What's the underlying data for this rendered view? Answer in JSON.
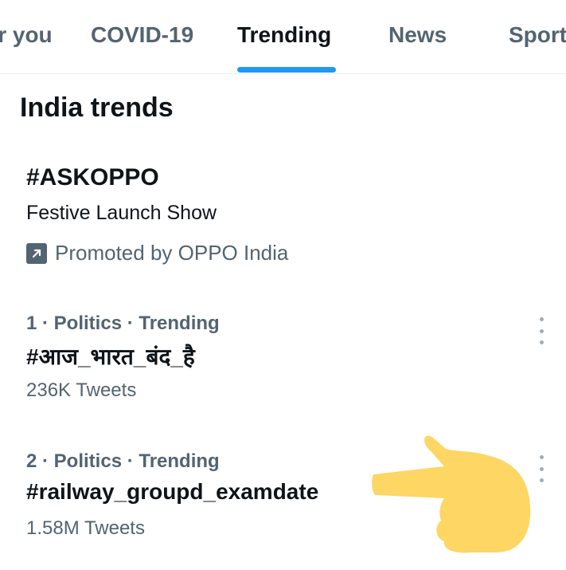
{
  "tabs": [
    {
      "label": "For you"
    },
    {
      "label": "COVID-19"
    },
    {
      "label": "Trending"
    },
    {
      "label": "News"
    },
    {
      "label": "Sports"
    }
  ],
  "section": {
    "title": "India trends"
  },
  "promoted": {
    "hashtag": "#ASKOPPO",
    "subtitle": "Festive Launch Show",
    "promoted_by": "Promoted by OPPO India",
    "icon": "promoted-arrow-icon"
  },
  "trends": [
    {
      "meta": "1 · Politics · Trending",
      "tag": "#आज_भारत_बंद_है",
      "count": "236K Tweets"
    },
    {
      "meta": "2 · Politics · Trending",
      "tag": "#railway_groupd_examdate",
      "count": "1.58M Tweets"
    }
  ],
  "colors": {
    "accent": "#1d9bf0",
    "text": "#0f1419",
    "secondary": "#536471",
    "overlay_hand": "#fdd663"
  }
}
